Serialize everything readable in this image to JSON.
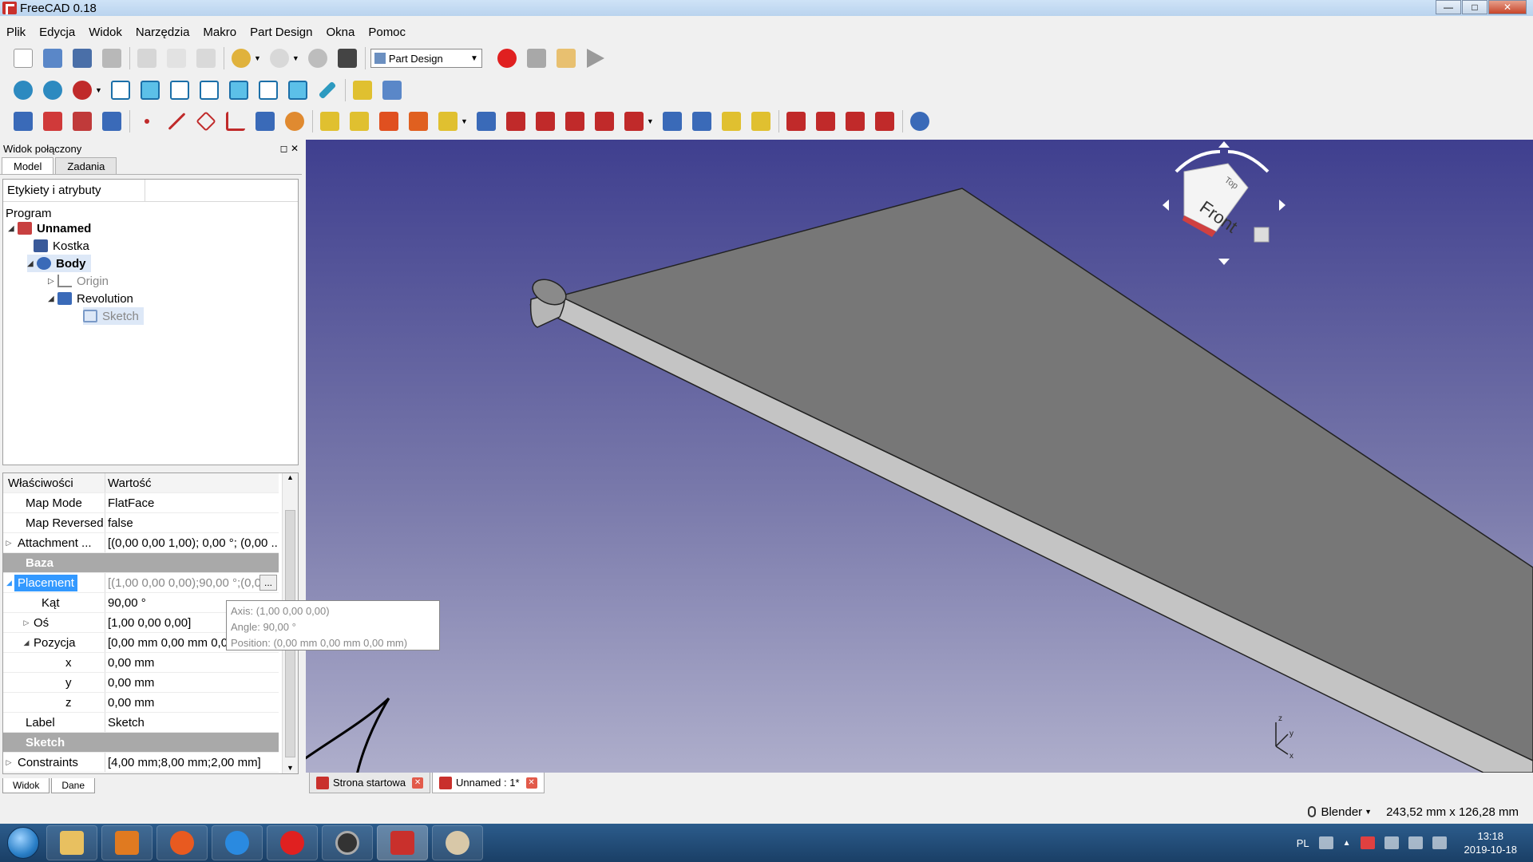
{
  "window": {
    "title": "FreeCAD 0.18"
  },
  "menubar": [
    "Plik",
    "Edycja",
    "Widok",
    "Narzędzia",
    "Makro",
    "Part Design",
    "Okna",
    "Pomoc"
  ],
  "toolbar": {
    "workbench": "Part Design"
  },
  "combo": {
    "title": "Widok połączony",
    "tabs": [
      "Model",
      "Zadania"
    ],
    "tree_header": "Etykiety i atrybuty",
    "tree": {
      "root": "Program",
      "doc": "Unnamed",
      "kostka": "Kostka",
      "body": "Body",
      "origin": "Origin",
      "revolution": "Revolution",
      "sketch": "Sketch"
    },
    "props": {
      "col_name": "Właściwości",
      "col_value": "Wartość",
      "map_mode": {
        "name": "Map Mode",
        "value": "FlatFace"
      },
      "map_reversed": {
        "name": "Map Reversed",
        "value": "false"
      },
      "attachment": {
        "name": "Attachment ...",
        "value": "[(0,00 0,00 1,00); 0,00 °; (0,00 ..."
      },
      "group_baza": "Baza",
      "placement": {
        "name": "Placement",
        "value": "[(1,00 0,00 0,00);90,00 °;(0,00 ..."
      },
      "kat": {
        "name": "Kąt",
        "value": "90,00 °"
      },
      "os": {
        "name": "Oś",
        "value": "[1,00 0,00 0,00]"
      },
      "pozycja": {
        "name": "Pozycja",
        "value": "[0,00 mm  0,00 mm  0,00 mm]"
      },
      "x": {
        "name": "x",
        "value": "0,00 mm"
      },
      "y": {
        "name": "y",
        "value": "0,00 mm"
      },
      "z": {
        "name": "z",
        "value": "0,00 mm"
      },
      "label": {
        "name": "Label",
        "value": "Sketch"
      },
      "group_sketch": "Sketch",
      "constraints": {
        "name": "Constraints",
        "value": "[4,00 mm;8,00 mm;2,00 mm]"
      }
    },
    "bottom_tabs": [
      "Widok",
      "Dane"
    ]
  },
  "tooltip": {
    "axis": "Axis: (1,00 0,00 0,00)",
    "angle": "Angle: 90,00 °",
    "position": "Position: (0,00 mm  0,00 mm  0,00 mm)"
  },
  "navcube": {
    "face": "Front",
    "top": "Top"
  },
  "doc_tabs": [
    "Strona startowa",
    "Unnamed : 1*"
  ],
  "statusbar": {
    "nav_style": "Blender",
    "dimensions": "243,52 mm x 126,28 mm"
  },
  "taskbar": {
    "lang": "PL",
    "time": "13:18",
    "date": "2019-10-18"
  },
  "colors": {
    "accent": "#3399ff",
    "viewport_top": "#3f3f8f",
    "viewport_bottom": "#aeaecb",
    "model_face": "#777777"
  }
}
